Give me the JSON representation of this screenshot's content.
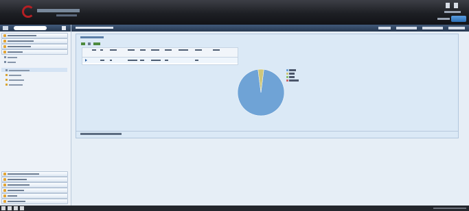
{
  "header": {
    "logo_word": "",
    "user_button_label": ""
  },
  "sidebar": {
    "search_placeholder": "",
    "items_top": [
      "",
      "",
      "",
      ""
    ],
    "items_bottom": [
      "",
      "",
      "",
      "",
      "",
      ""
    ]
  },
  "breadcrumb": {
    "text": "",
    "actions": [
      "",
      "",
      "",
      ""
    ]
  },
  "panel": {
    "title": "",
    "status": ""
  },
  "grid": {
    "columns": [
      "",
      "",
      "",
      "",
      "",
      "",
      "",
      "",
      "",
      ""
    ],
    "rows": [
      [
        "",
        "",
        "",
        "",
        "",
        "",
        "",
        "",
        "",
        ""
      ]
    ]
  },
  "chart_data": {
    "type": "pie",
    "title": "",
    "legend_placement": "right",
    "series": [
      {
        "name": "",
        "value": 96,
        "color": "#6fa3d6"
      },
      {
        "name": "",
        "value": 4,
        "color": "#cfc77a"
      },
      {
        "name": "",
        "value": 0,
        "color": "#8bc06a"
      },
      {
        "name": "",
        "value": 0,
        "color": "#c66"
      }
    ]
  },
  "colors": {
    "header_bg": "#1d1f24",
    "accent": "#2d6fb5",
    "panel_bg": "#dbe9f6",
    "brand_red": "#b51f24"
  }
}
